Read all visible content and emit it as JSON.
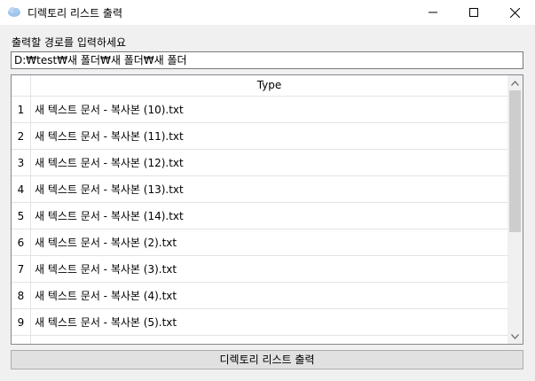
{
  "window": {
    "title": "디렉토리 리스트 출력",
    "icon": "app-cloud-icon"
  },
  "form": {
    "prompt_label": "출력할 경로를 입력하세요",
    "path_value": "D:₩test₩새 폴더₩새 폴더₩새 폴더"
  },
  "grid": {
    "column_header": "Type",
    "rows": [
      {
        "num": "1",
        "name": "새 텍스트 문서 - 복사본 (10).txt"
      },
      {
        "num": "2",
        "name": "새 텍스트 문서 - 복사본 (11).txt"
      },
      {
        "num": "3",
        "name": "새 텍스트 문서 - 복사본 (12).txt"
      },
      {
        "num": "4",
        "name": "새 텍스트 문서 - 복사본 (13).txt"
      },
      {
        "num": "5",
        "name": "새 텍스트 문서 - 복사본 (14).txt"
      },
      {
        "num": "6",
        "name": "새 텍스트 문서 - 복사본 (2).txt"
      },
      {
        "num": "7",
        "name": "새 텍스트 문서 - 복사본 (3).txt"
      },
      {
        "num": "8",
        "name": "새 텍스트 문서 - 복사본 (4).txt"
      },
      {
        "num": "9",
        "name": "새 텍스트 문서 - 복사본 (5).txt"
      },
      {
        "num": "",
        "name": ""
      }
    ]
  },
  "action_button_label": "디렉토리 리스트 출력"
}
